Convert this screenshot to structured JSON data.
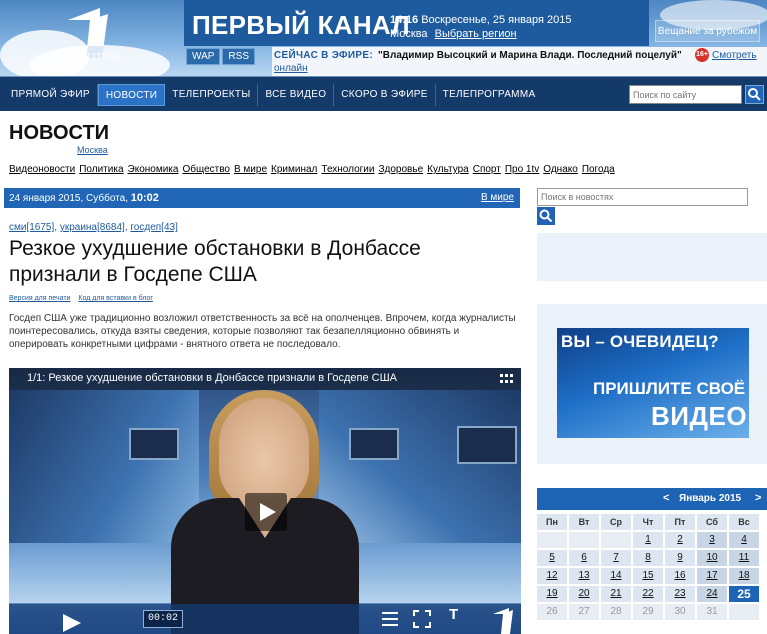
{
  "header": {
    "logo_url": "WWW.1TV.RU",
    "brand": "ПЕРВЫЙ КАНАЛ",
    "time": "14:16",
    "date": "Воскресенье, 25 января 2015",
    "city": "Москва",
    "region_link": "Выбрать регион",
    "abroad": "Вещание за рубежом",
    "wap": "WAP",
    "rss": "RSS",
    "onair_label": "СЕЙЧАС В ЭФИРЕ:",
    "onair_title": "\"Владимир Высоцкий и Марина Влади. Последний поцелуй\"",
    "age": "16+",
    "watch": "Смотреть",
    "online": "онлайн"
  },
  "nav": {
    "items": [
      "ПРЯМОЙ ЭФИР",
      "НОВОСТИ",
      "ТЕЛЕПРОЕКТЫ",
      "ВСЕ ВИДЕО",
      "СКОРО В ЭФИРЕ",
      "ТЕЛЕПРОГРАММА"
    ],
    "active": "НОВОСТИ",
    "search_placeholder": "Поиск по сайту"
  },
  "section": {
    "title": "НОВОСТИ",
    "subtitle": "Москва",
    "categories": [
      "Видеоновости",
      "Политика",
      "Экономика",
      "Общество",
      "В мире",
      "Криминал",
      "Технологии",
      "Здоровье",
      "Культура",
      "Спорт",
      "Про 1tv",
      "Однако",
      "Погода"
    ]
  },
  "datebar": {
    "date": "24 января 2015, Суббота,",
    "time": "10:02",
    "link": "В мире"
  },
  "article": {
    "tags": [
      "сми[1675]",
      "украина[8684]",
      "госдеп[43]"
    ],
    "headline": "Резкое ухудшение обстановки в Донбассе признали в Госдепе США",
    "print_link": "Версия для печати",
    "embed_link": "Код для вставки в блог",
    "lead": "Госдеп США уже традиционно возложил ответственность за всё на ополченцев. Впрочем, когда журналисты поинтересовались, откуда взяты сведения, которые позволяют так безапелляционно обвинять и оперировать конкретными цифрами - внятного ответа не последовало."
  },
  "video": {
    "title": "1/1: Резкое ухудшение обстановки в Донбассе признали в Госдепе США",
    "time": "00:02",
    "text_btn": "T"
  },
  "sidebar": {
    "search_placeholder": "Поиск в новостях",
    "promo_line1": "ВЫ – ОЧЕВИДЕЦ?",
    "promo_line2": "ПРИШЛИТЕ СВОЁ",
    "promo_line3": "ВИДЕО"
  },
  "calendar": {
    "prev": "<",
    "month": "Январь 2015",
    "next": ">",
    "weekdays": [
      "Пн",
      "Вт",
      "Ср",
      "Чт",
      "Пт",
      "Сб",
      "Вс"
    ],
    "rows": [
      [
        "",
        "",
        "",
        "1",
        "2",
        "3",
        "4"
      ],
      [
        "5",
        "6",
        "7",
        "8",
        "9",
        "10",
        "11"
      ],
      [
        "12",
        "13",
        "14",
        "15",
        "16",
        "17",
        "18"
      ],
      [
        "19",
        "20",
        "21",
        "22",
        "23",
        "24",
        "25"
      ],
      [
        "26",
        "27",
        "28",
        "29",
        "30",
        "31",
        ""
      ]
    ],
    "today": "25",
    "disabled_from": 26
  },
  "colors": {
    "brand_blue": "#1d5b9e",
    "nav_bg": "#143a6a",
    "accent": "#2166b6"
  }
}
